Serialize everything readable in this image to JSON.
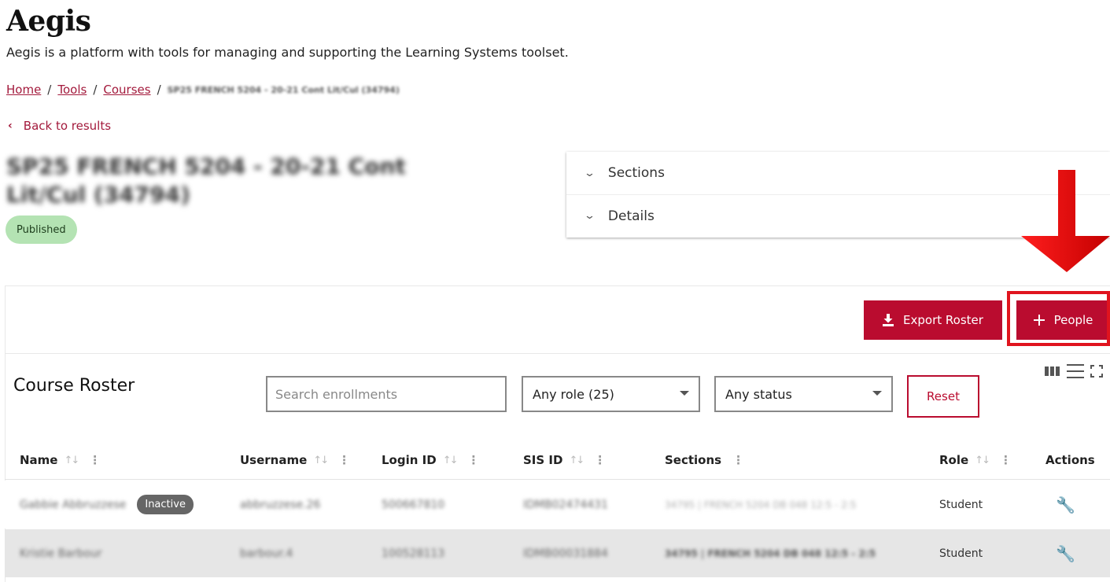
{
  "header": {
    "title": "Aegis",
    "description": "Aegis is a platform with tools for managing and supporting the Learning Systems toolset."
  },
  "breadcrumb": {
    "home": "Home",
    "tools": "Tools",
    "courses": "Courses",
    "current": "SP25 FRENCH 5204 - 20-21 Cont Lit/Cul (34794)"
  },
  "back_link": "Back to results",
  "course": {
    "title": "SP25 FRENCH 5204 - 20-21 Cont Lit/Cul (34794)",
    "status": "Published"
  },
  "accordion": {
    "sections_label": "Sections",
    "details_label": "Details"
  },
  "toolbar": {
    "export_label": "Export Roster",
    "people_label": "People"
  },
  "roster": {
    "title": "Course Roster",
    "search_placeholder": "Search enrollments",
    "role_filter": "Any role (25)",
    "status_filter": "Any status",
    "reset_label": "Reset",
    "columns": {
      "name": "Name",
      "username": "Username",
      "login_id": "Login ID",
      "sis_id": "SIS ID",
      "sections": "Sections",
      "role": "Role",
      "actions": "Actions"
    },
    "rows": [
      {
        "name": "Gabbie Abbruzzese",
        "badge": "Inactive",
        "username": "abbruzzese.26",
        "login_id": "500667810",
        "sis_id": "IDMB02474431",
        "sections": "34795 | FRENCH 5204 DB 048 12:5 - 2:5",
        "role": "Student"
      },
      {
        "name": "Kristie Barbour",
        "username": "barbour.4",
        "login_id": "100528113",
        "sis_id": "IDMB00031884",
        "sections": "34795 | FRENCH 5204 DB 048 12:5 - 2:5",
        "role": "Student"
      }
    ]
  },
  "colors": {
    "brand": "#ba0c2f",
    "link": "#a31a3c",
    "published_badge": "#b4e3b3",
    "highlight": "#e0141e"
  },
  "icons": [
    "chevron-left-icon",
    "chevron-down-icon",
    "download-icon",
    "plus-icon",
    "sort-icon",
    "kebab-icon",
    "wrench-icon",
    "columns-icon",
    "density-icon",
    "fullscreen-icon",
    "arrow-down-annotation"
  ]
}
